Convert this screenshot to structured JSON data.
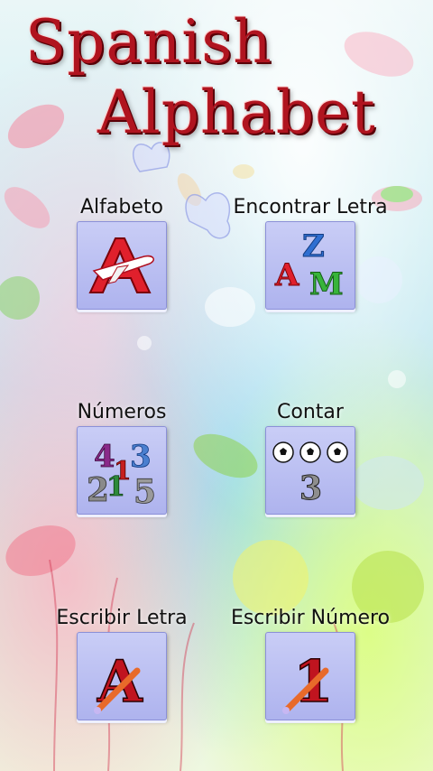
{
  "title": {
    "line1": "Spanish",
    "line2": "Alphabet"
  },
  "menu": {
    "alfabeto": {
      "label": "Alfabeto",
      "icon": "letter-a-airplane-icon"
    },
    "encontrar_letra": {
      "label": "Encontrar Letra",
      "icon": "letters-azm-icon",
      "glyphs": [
        "Z",
        "A",
        "M"
      ]
    },
    "numeros": {
      "label": "Números",
      "icon": "numbers-icon",
      "glyphs": [
        "4",
        "1",
        "3",
        "2",
        "1",
        "5"
      ]
    },
    "contar": {
      "label": "Contar",
      "icon": "soccer-balls-count-icon",
      "glyphs": [
        "3"
      ]
    },
    "escribir_letra": {
      "label": "Escribir Letra",
      "icon": "write-letter-a-icon",
      "glyphs": [
        "A"
      ]
    },
    "escribir_numero": {
      "label": "Escribir Número",
      "icon": "write-number-1-icon",
      "glyphs": [
        "1"
      ]
    }
  },
  "colors": {
    "title": "#b0141f",
    "tile": "#b7bbf1"
  }
}
